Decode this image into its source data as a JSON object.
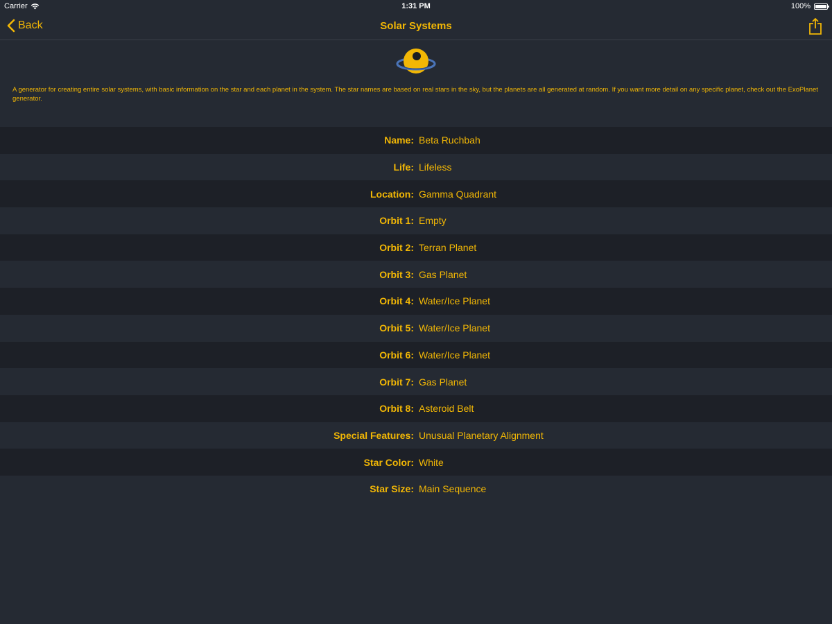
{
  "status_bar": {
    "carrier": "Carrier",
    "time": "1:31 PM",
    "battery": "100%"
  },
  "nav": {
    "back_label": "Back",
    "title": "Solar Systems"
  },
  "icons": {
    "back": "chevron-left-icon",
    "share": "share-icon",
    "logo": "planet-icon",
    "wifi": "wifi-icon",
    "battery": "battery-icon"
  },
  "colors": {
    "accent": "#f2b705",
    "background": "#252a33",
    "row_alt": "#1d2027"
  },
  "description": "A generator for creating entire solar systems, with basic information on the star and each planet in the system. The star names are based on real stars in the sky, but the planets are all generated at random. If you want more detail on any specific planet, check out the ExoPlanet generator.",
  "rows": [
    {
      "label": "Name:",
      "value": "Beta Ruchbah"
    },
    {
      "label": "Life:",
      "value": "Lifeless"
    },
    {
      "label": "Location:",
      "value": "Gamma Quadrant"
    },
    {
      "label": "Orbit 1:",
      "value": "Empty"
    },
    {
      "label": "Orbit 2:",
      "value": "Terran Planet"
    },
    {
      "label": "Orbit 3:",
      "value": "Gas Planet"
    },
    {
      "label": "Orbit 4:",
      "value": "Water/Ice Planet"
    },
    {
      "label": "Orbit 5:",
      "value": "Water/Ice Planet"
    },
    {
      "label": "Orbit 6:",
      "value": "Water/Ice Planet"
    },
    {
      "label": "Orbit 7:",
      "value": "Gas Planet"
    },
    {
      "label": "Orbit 8:",
      "value": "Asteroid Belt"
    },
    {
      "label": "Special Features:",
      "value": "Unusual Planetary Alignment"
    },
    {
      "label": "Star Color:",
      "value": "White"
    },
    {
      "label": "Star Size:",
      "value": "Main Sequence"
    }
  ]
}
